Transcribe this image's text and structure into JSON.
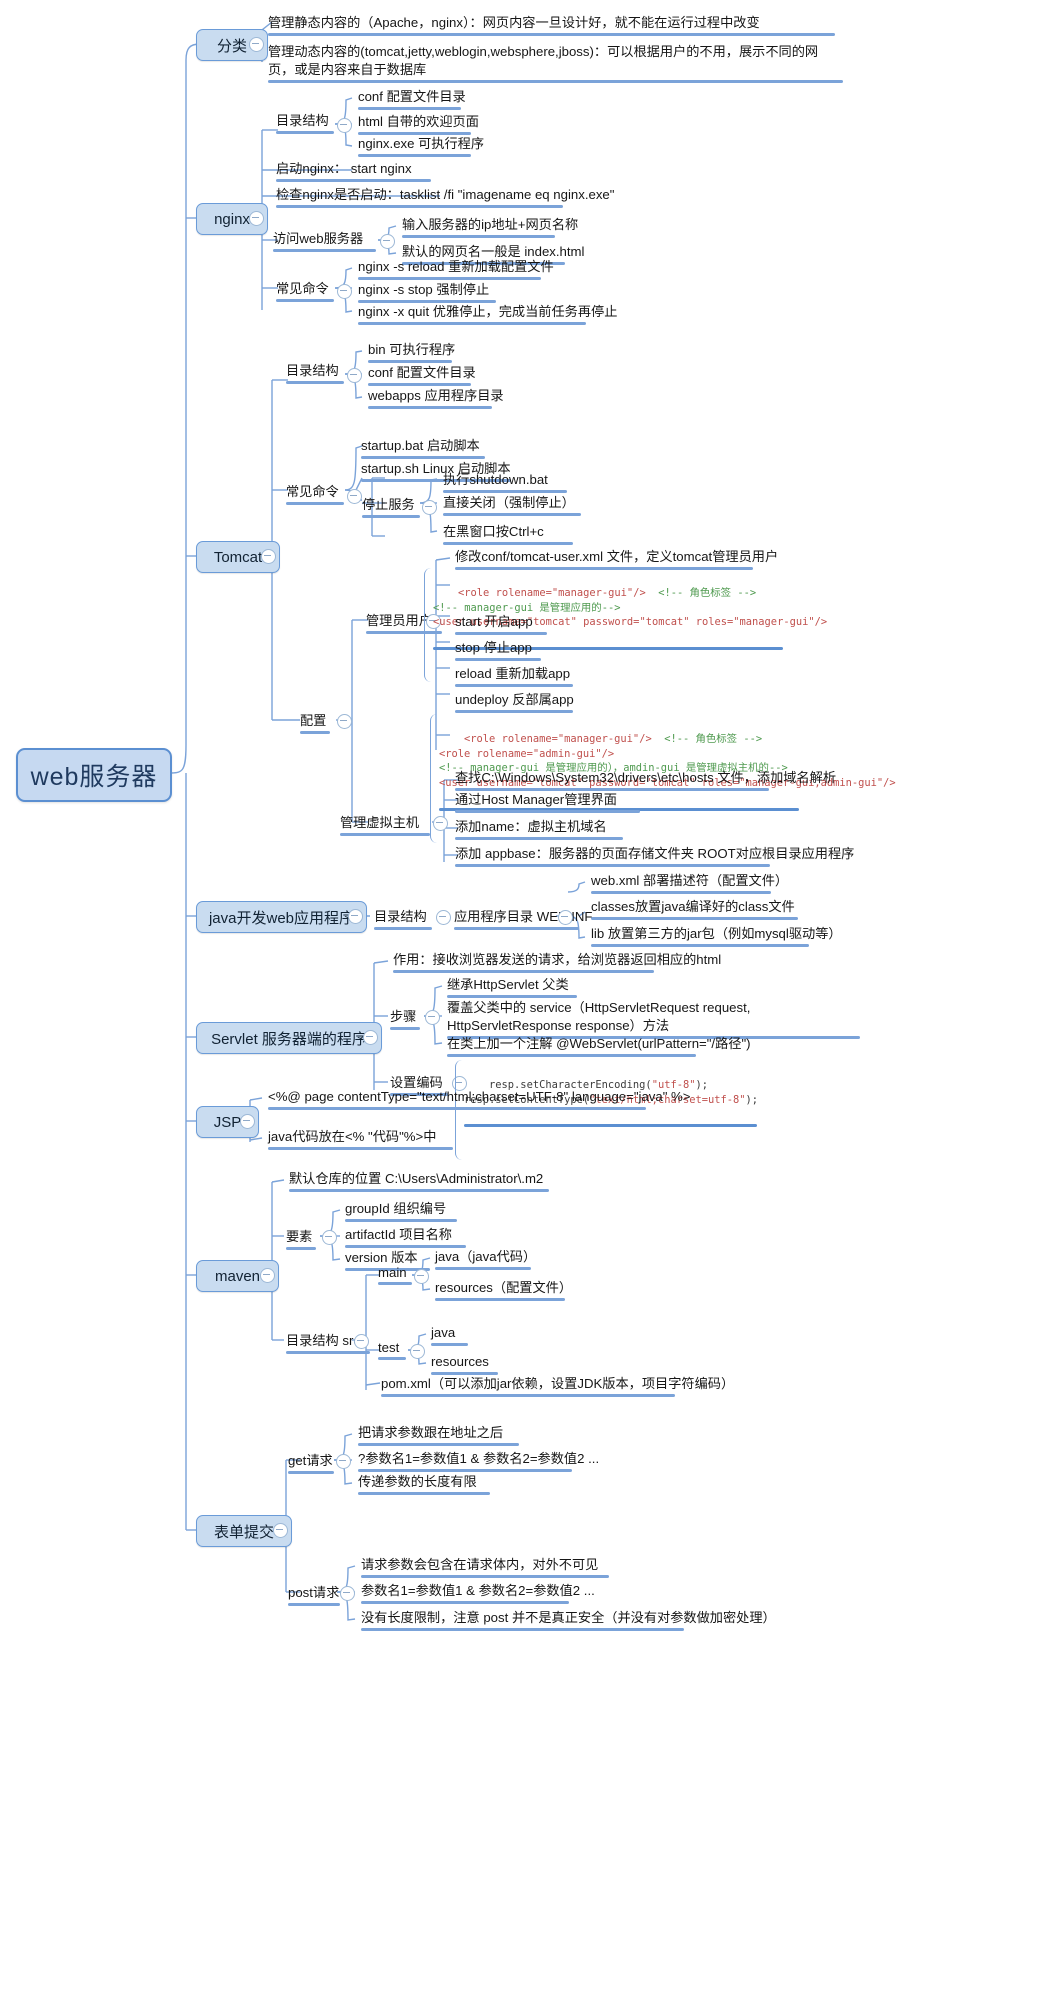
{
  "title": "web服务器",
  "theme": {
    "accent": "#5b8fd1",
    "node_fill": "#c9dcf0",
    "line": "#7ba3d9",
    "code_tag": "#c0504d",
    "code_comment": "#4f9a4f"
  },
  "root": {
    "label": "web服务器"
  },
  "branches": {
    "fenlei": {
      "label": "分类",
      "items": [
        "管理静态内容的（Apache，nginx）：网页内容一旦设计好，就不能在运行过程中改变",
        "管理动态内容的(tomcat,jetty,weblogin,websphere,jboss)：可以根据用户的不用，展示不同的网页，或是内容来自于数据库"
      ]
    },
    "nginx": {
      "label": "nginx",
      "dir_label": "目录结构",
      "dir_items": [
        "conf 配置文件目录",
        "html 自带的欢迎页面",
        "nginx.exe 可执行程序"
      ],
      "start": "启动nginx： start nginx",
      "check": "检查nginx是否启动：tasklist /fi \"imagename eq nginx.exe\"",
      "visit_label": "访问web服务器",
      "visit_items": [
        "输入服务器的ip地址+网页名称",
        "默认的网页名一般是 index.html"
      ],
      "cmd_label": "常见命令",
      "cmd_items": [
        "nginx -s reload  重新加载配置文件",
        "nginx -s stop 强制停止",
        "nginx -x quit 优雅停止，完成当前任务再停止"
      ]
    },
    "tomcat": {
      "label": "Tomcat",
      "dir_label": "目录结构",
      "dir_items": [
        "bin 可执行程序",
        "conf 配置文件目录",
        "webapps 应用程序目录"
      ],
      "cmd_label": "常见命令",
      "cmd_items": [
        "startup.bat 启动脚本",
        "startup.sh Linux 启动脚本"
      ],
      "stop_label": "停止服务",
      "stop_items": [
        "执行shutdown.bat",
        "直接关闭（强制停止）",
        "在黑窗口按Ctrl+c"
      ],
      "config_label": "配置",
      "admin_label": "管理员用户",
      "admin_first": "修改conf/tomcat-user.xml 文件，定义tomcat管理员用户",
      "admin_code1": [
        [
          {
            "t": "<role rolename=\"manager-gui\"/>  ",
            "c": "tag"
          },
          {
            "t": "<!-- 角色标签 -->",
            "c": "cmt"
          }
        ],
        [
          {
            "t": "<!-- manager-gui 是管理应用的-->",
            "c": "cmt"
          }
        ],
        [
          {
            "t": "<user username=\"tomcat\" password=\"tomcat\" roles=\"manager-gui\"/>",
            "c": "tag"
          }
        ]
      ],
      "admin_items": [
        "start 开启app",
        "stop 停止app",
        "reload 重新加载app",
        "undeploy 反部属app"
      ],
      "admin_code2": [
        [
          {
            "t": "<role rolename=\"manager-gui\"/>  ",
            "c": "tag"
          },
          {
            "t": "<!-- 角色标签 -->",
            "c": "cmt"
          }
        ],
        [
          {
            "t": "<role rolename=\"admin-gui\"/>",
            "c": "tag"
          }
        ],
        [
          {
            "t": "<!-- manager-gui 是管理应用的），amdin-gui 是管理虚拟主机的-->",
            "c": "cmt"
          }
        ],
        [
          {
            "t": "<user username=\"tomcat\" password=\"tomcat\" roles=\"manager-gui,admin-gui\"/>",
            "c": "tag"
          }
        ]
      ],
      "vhost_label": "管理虚拟主机",
      "vhost_items": [
        "查找C:\\Windows\\System32\\drivers\\etc\\hosts 文件，添加域名解析",
        "通过Host Manager管理界面",
        "添加name：虚拟主机域名",
        "添加 appbase：服务器的页面存储文件夹  ROOT对应根目录应用程序"
      ]
    },
    "javaweb": {
      "label": "java开发web应用程序",
      "dir_label": "目录结构",
      "webinf": "应用程序目录 WEB-INF",
      "items": [
        "web.xml 部署描述符（配置文件）",
        "classes放置java编译好的class文件",
        "lib 放置第三方的jar包（例如mysql驱动等）"
      ]
    },
    "servlet": {
      "label": "Servlet 服务器端的程序",
      "role": "作用：接收浏览器发送的请求，给浏览器返回相应的html",
      "steps_label": "步骤",
      "steps": [
        "继承HttpServlet 父类",
        "覆盖父类中的 service（HttpServletRequest request, HttpServletResponse response）方法",
        "在类上加一个注解 @WebServlet(urlPattern=\"/路径\")"
      ],
      "encoding_label": "设置编码",
      "encoding_code": [
        [
          {
            "t": "resp.setCharacterEncoding(",
            "c": "blk"
          },
          {
            "t": "\"utf-8\"",
            "c": "str"
          },
          {
            "t": ");",
            "c": "blk"
          }
        ],
        [
          {
            "t": "resp.setContentType(",
            "c": "blk"
          },
          {
            "t": "\"text/html;charset=utf-8\"",
            "c": "str"
          },
          {
            "t": ");",
            "c": "blk"
          }
        ]
      ]
    },
    "jsp": {
      "label": "JSP",
      "items": [
        "<%@ page contentType=\"text/html;charset=UTF-8\" language=\"java\" %>",
        "java代码放在<% \"代码\"%>中"
      ]
    },
    "maven": {
      "label": "maven",
      "repo": "默认仓库的位置 C:\\Users\\Administrator\\.m2",
      "elem_label": "要素",
      "elem_items": [
        "groupId 组织编号",
        "artifactId 项目名称",
        "version 版本"
      ],
      "dir_label": "目录结构 src",
      "main_label": "main",
      "main_items": [
        "java（java代码）",
        "resources（配置文件）"
      ],
      "test_label": "test",
      "test_items": [
        "java",
        "resources"
      ],
      "pom": "pom.xml（可以添加jar依赖，设置JDK版本，项目字符编码）"
    },
    "form": {
      "label": "表单提交",
      "get_label": "get请求",
      "get_items": [
        "把请求参数跟在地址之后",
        "?参数名1=参数值1 & 参数名2=参数值2 ...",
        "传递参数的长度有限"
      ],
      "post_label": "post请求",
      "post_items": [
        "请求参数会包含在请求体内，对外不可见",
        "参数名1=参数值1 & 参数名2=参数值2 ...",
        "没有长度限制，注意 post 并不是真正安全（并没有对参数做加密处理）"
      ]
    }
  }
}
